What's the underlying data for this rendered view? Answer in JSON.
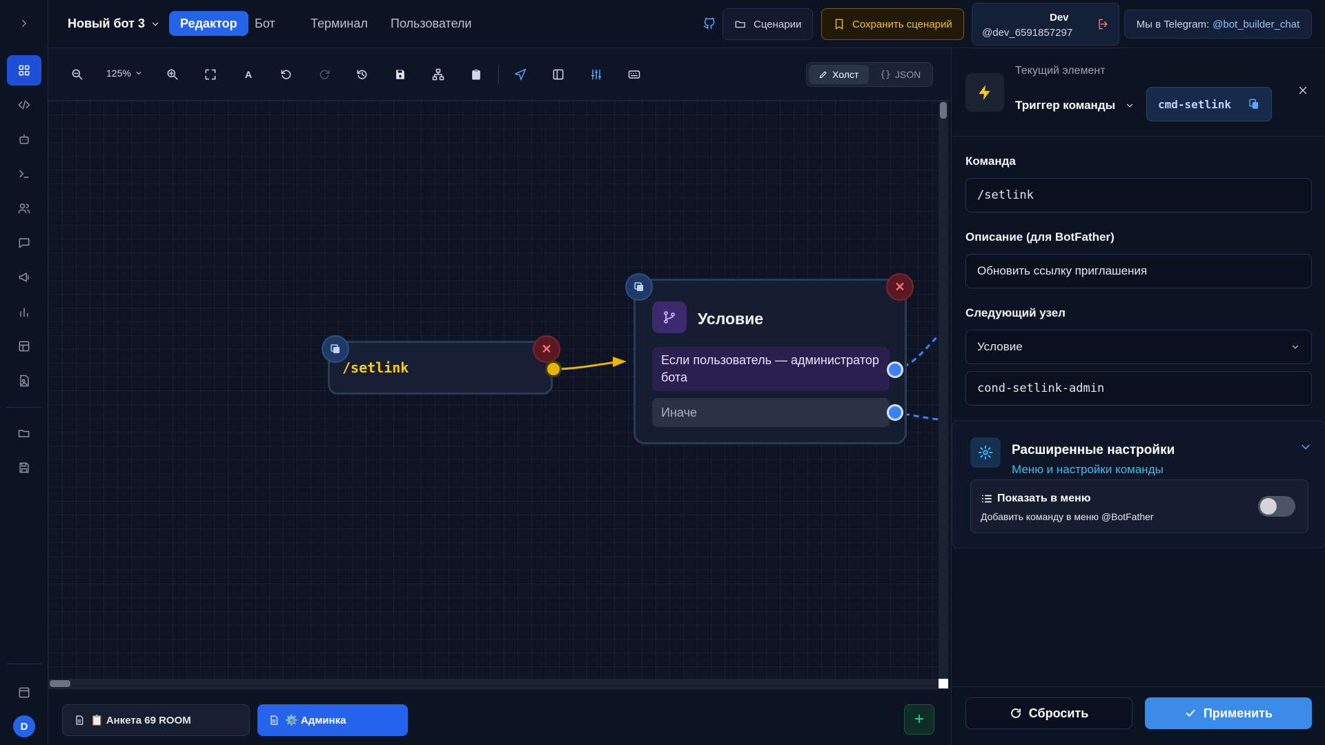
{
  "header": {
    "bot_name": "Новый бот 3",
    "tabs": [
      {
        "label": "Редактор",
        "active": true
      },
      {
        "label": "Бот",
        "active": false
      },
      {
        "label": "Терминал",
        "active": false
      },
      {
        "label": "Пользователи",
        "active": false
      }
    ],
    "scenarios_label": "Сценарии",
    "save_label": "Сохранить сценарий",
    "dev_title": "Dev",
    "dev_handle": "@dev_6591857297",
    "telegram_prefix": "Мы в Telegram:",
    "telegram_link": "@bot_builder_chat"
  },
  "toolbar": {
    "zoom_level": "125%",
    "font_tool_label": "A",
    "view_canvas": "Холст",
    "view_json": "JSON",
    "active_view": "canvas"
  },
  "canvas": {
    "trigger_node": {
      "command": "/setlink"
    },
    "condition_node": {
      "title": "Условие",
      "branch_if": "Если пользователь — администратор бота",
      "branch_else": "Иначе"
    }
  },
  "bottom_tabs": [
    {
      "label": "📋 Анкета 69 ROOM",
      "active": false
    },
    {
      "label": "⚙️ Админка",
      "active": true
    }
  ],
  "avatar_letter": "D",
  "panel": {
    "caption": "Текущий элемент",
    "type_label": "Триггер команды",
    "element_id": "cmd-setlink",
    "fields": {
      "command_label": "Команда",
      "command_value": "/setlink",
      "description_label": "Описание (для BotFather)",
      "description_value": "Обновить ссылку приглашения",
      "next_node_label": "Следующий узел",
      "next_node_value": "Условие",
      "next_node_id": "cond-setlink-admin"
    },
    "advanced": {
      "title": "Расширенные настройки",
      "subtitle": "Меню и настройки команды",
      "option_title": "Показать в меню",
      "option_desc": "Добавить команду в меню @BotFather",
      "option_enabled": false
    },
    "reset_label": "Сбросить",
    "apply_label": "Применить"
  },
  "colors": {
    "accent": "#2563eb",
    "trigger": "#facc15",
    "condition": "#c4b5fd",
    "info": "#38bdf8",
    "danger": "#f87171"
  }
}
